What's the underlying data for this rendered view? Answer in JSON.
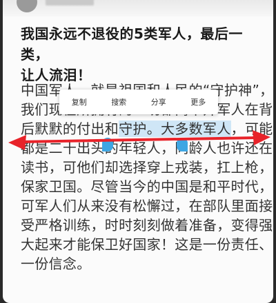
{
  "article": {
    "title_line1": "我国永远不退役的5类军人，最后一类，",
    "title_line2": "让人流泪！",
    "lines": [
      "中国军人，就是祖国和人民的“守护神”，",
      "我们现在所拥有的一切都离不开军人在背",
      "后默默的付出和守护。大多数军人，可能",
      "都是二十出头的年轻人，同龄人也许还在",
      "读书，可他们却选择穿上戎装，扛上枪，",
      "保家卫国。尽管当今的中国是和平时代，",
      "可军人们从来没有松懈过，在部队里面接",
      "受严格训练，时时刻刻做着准备，变得强",
      "大起来才能保卫好国家！这是一份责任、",
      "一份信念。"
    ],
    "line3_before": "后默默的付出和",
    "line3_selected": "守护。大多数军人",
    "line3_after": "，可能"
  },
  "context_menu": {
    "items": [
      "复制",
      "搜索",
      "分享",
      "更多"
    ]
  },
  "colors": {
    "selection": "#cfe6f6",
    "handle": "#3ea6e3",
    "arrow": "#e8232a"
  }
}
